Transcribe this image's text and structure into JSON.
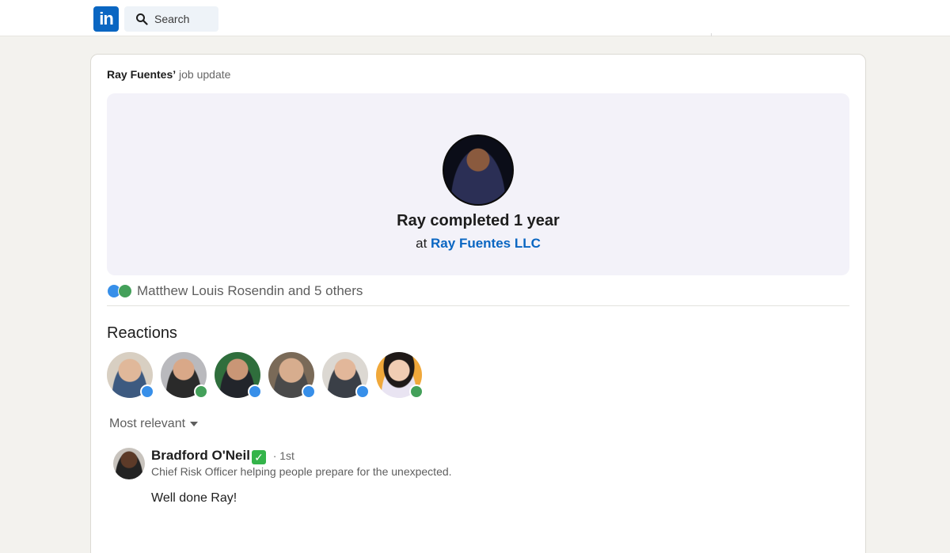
{
  "topbar": {
    "logo_text": "in",
    "search_label": "Search"
  },
  "post": {
    "author_name": "Ray Fuentes’",
    "header_suffix": "job update",
    "hero": {
      "title": "Ray completed 1 year",
      "at_label": "at",
      "company": "Ray Fuentes LLC"
    },
    "social_proof": "Matthew Louis Rosendin and 5 others"
  },
  "reactions": {
    "heading": "Reactions",
    "reactors": [
      {
        "reaction": "like",
        "color": "#c9b8a4"
      },
      {
        "reaction": "support",
        "color": "#a9a9ad"
      },
      {
        "reaction": "like",
        "color": "#2f6e3c"
      },
      {
        "reaction": "like",
        "color": "#7a6a58"
      },
      {
        "reaction": "like",
        "color": "#c9c4bd"
      },
      {
        "reaction": "support",
        "color": "#f0a83a"
      }
    ]
  },
  "comments": {
    "sort_label": "Most relevant",
    "items": [
      {
        "name": "Bradford O'Neil",
        "verified_icon": "✓",
        "degree": "· 1st",
        "headline": "Chief Risk Officer helping people prepare for the unexpected.",
        "text": "Well done Ray!"
      }
    ]
  }
}
